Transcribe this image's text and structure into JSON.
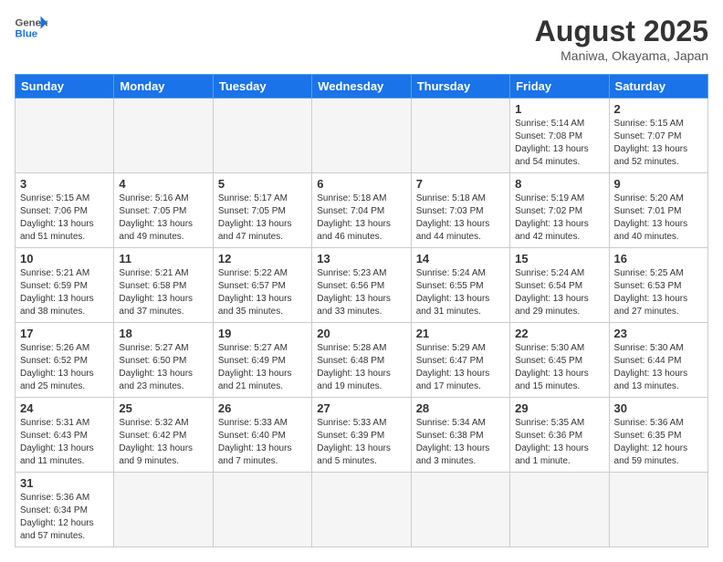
{
  "header": {
    "logo_general": "General",
    "logo_blue": "Blue",
    "month_title": "August 2025",
    "location": "Maniwa, Okayama, Japan"
  },
  "weekdays": [
    "Sunday",
    "Monday",
    "Tuesday",
    "Wednesday",
    "Thursday",
    "Friday",
    "Saturday"
  ],
  "weeks": [
    [
      {
        "day": "",
        "info": ""
      },
      {
        "day": "",
        "info": ""
      },
      {
        "day": "",
        "info": ""
      },
      {
        "day": "",
        "info": ""
      },
      {
        "day": "",
        "info": ""
      },
      {
        "day": "1",
        "info": "Sunrise: 5:14 AM\nSunset: 7:08 PM\nDaylight: 13 hours and 54 minutes."
      },
      {
        "day": "2",
        "info": "Sunrise: 5:15 AM\nSunset: 7:07 PM\nDaylight: 13 hours and 52 minutes."
      }
    ],
    [
      {
        "day": "3",
        "info": "Sunrise: 5:15 AM\nSunset: 7:06 PM\nDaylight: 13 hours and 51 minutes."
      },
      {
        "day": "4",
        "info": "Sunrise: 5:16 AM\nSunset: 7:05 PM\nDaylight: 13 hours and 49 minutes."
      },
      {
        "day": "5",
        "info": "Sunrise: 5:17 AM\nSunset: 7:05 PM\nDaylight: 13 hours and 47 minutes."
      },
      {
        "day": "6",
        "info": "Sunrise: 5:18 AM\nSunset: 7:04 PM\nDaylight: 13 hours and 46 minutes."
      },
      {
        "day": "7",
        "info": "Sunrise: 5:18 AM\nSunset: 7:03 PM\nDaylight: 13 hours and 44 minutes."
      },
      {
        "day": "8",
        "info": "Sunrise: 5:19 AM\nSunset: 7:02 PM\nDaylight: 13 hours and 42 minutes."
      },
      {
        "day": "9",
        "info": "Sunrise: 5:20 AM\nSunset: 7:01 PM\nDaylight: 13 hours and 40 minutes."
      }
    ],
    [
      {
        "day": "10",
        "info": "Sunrise: 5:21 AM\nSunset: 6:59 PM\nDaylight: 13 hours and 38 minutes."
      },
      {
        "day": "11",
        "info": "Sunrise: 5:21 AM\nSunset: 6:58 PM\nDaylight: 13 hours and 37 minutes."
      },
      {
        "day": "12",
        "info": "Sunrise: 5:22 AM\nSunset: 6:57 PM\nDaylight: 13 hours and 35 minutes."
      },
      {
        "day": "13",
        "info": "Sunrise: 5:23 AM\nSunset: 6:56 PM\nDaylight: 13 hours and 33 minutes."
      },
      {
        "day": "14",
        "info": "Sunrise: 5:24 AM\nSunset: 6:55 PM\nDaylight: 13 hours and 31 minutes."
      },
      {
        "day": "15",
        "info": "Sunrise: 5:24 AM\nSunset: 6:54 PM\nDaylight: 13 hours and 29 minutes."
      },
      {
        "day": "16",
        "info": "Sunrise: 5:25 AM\nSunset: 6:53 PM\nDaylight: 13 hours and 27 minutes."
      }
    ],
    [
      {
        "day": "17",
        "info": "Sunrise: 5:26 AM\nSunset: 6:52 PM\nDaylight: 13 hours and 25 minutes."
      },
      {
        "day": "18",
        "info": "Sunrise: 5:27 AM\nSunset: 6:50 PM\nDaylight: 13 hours and 23 minutes."
      },
      {
        "day": "19",
        "info": "Sunrise: 5:27 AM\nSunset: 6:49 PM\nDaylight: 13 hours and 21 minutes."
      },
      {
        "day": "20",
        "info": "Sunrise: 5:28 AM\nSunset: 6:48 PM\nDaylight: 13 hours and 19 minutes."
      },
      {
        "day": "21",
        "info": "Sunrise: 5:29 AM\nSunset: 6:47 PM\nDaylight: 13 hours and 17 minutes."
      },
      {
        "day": "22",
        "info": "Sunrise: 5:30 AM\nSunset: 6:45 PM\nDaylight: 13 hours and 15 minutes."
      },
      {
        "day": "23",
        "info": "Sunrise: 5:30 AM\nSunset: 6:44 PM\nDaylight: 13 hours and 13 minutes."
      }
    ],
    [
      {
        "day": "24",
        "info": "Sunrise: 5:31 AM\nSunset: 6:43 PM\nDaylight: 13 hours and 11 minutes."
      },
      {
        "day": "25",
        "info": "Sunrise: 5:32 AM\nSunset: 6:42 PM\nDaylight: 13 hours and 9 minutes."
      },
      {
        "day": "26",
        "info": "Sunrise: 5:33 AM\nSunset: 6:40 PM\nDaylight: 13 hours and 7 minutes."
      },
      {
        "day": "27",
        "info": "Sunrise: 5:33 AM\nSunset: 6:39 PM\nDaylight: 13 hours and 5 minutes."
      },
      {
        "day": "28",
        "info": "Sunrise: 5:34 AM\nSunset: 6:38 PM\nDaylight: 13 hours and 3 minutes."
      },
      {
        "day": "29",
        "info": "Sunrise: 5:35 AM\nSunset: 6:36 PM\nDaylight: 13 hours and 1 minute."
      },
      {
        "day": "30",
        "info": "Sunrise: 5:36 AM\nSunset: 6:35 PM\nDaylight: 12 hours and 59 minutes."
      }
    ],
    [
      {
        "day": "31",
        "info": "Sunrise: 5:36 AM\nSunset: 6:34 PM\nDaylight: 12 hours and 57 minutes."
      },
      {
        "day": "",
        "info": ""
      },
      {
        "day": "",
        "info": ""
      },
      {
        "day": "",
        "info": ""
      },
      {
        "day": "",
        "info": ""
      },
      {
        "day": "",
        "info": ""
      },
      {
        "day": "",
        "info": ""
      }
    ]
  ]
}
